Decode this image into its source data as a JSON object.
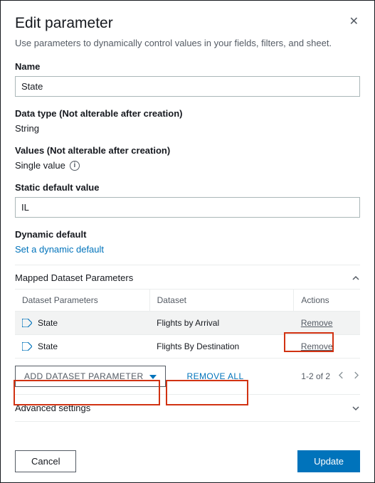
{
  "dialog": {
    "title": "Edit parameter",
    "subtitle": "Use parameters to dynamically control values in your fields, filters, and sheet."
  },
  "fields": {
    "name_label": "Name",
    "name_value": "State",
    "datatype_label": "Data type (Not alterable after creation)",
    "datatype_value": "String",
    "values_label": "Values (Not alterable after creation)",
    "values_value": "Single value",
    "static_label": "Static default value",
    "static_value": "IL",
    "dynamic_label": "Dynamic default",
    "dynamic_link": "Set a dynamic default"
  },
  "mapped": {
    "section_title": "Mapped Dataset Parameters",
    "col_param": "Dataset Parameters",
    "col_dataset": "Dataset",
    "col_actions": "Actions",
    "rows": [
      {
        "param": "State",
        "dataset": "Flights by Arrival",
        "action": "Remove"
      },
      {
        "param": "State",
        "dataset": "Flights By Destination",
        "action": "Remove"
      }
    ],
    "add_btn": "ADD DATASET PARAMETER",
    "remove_all": "REMOVE ALL",
    "pager": "1-2 of 2"
  },
  "advanced": {
    "title": "Advanced settings"
  },
  "footer": {
    "cancel": "Cancel",
    "update": "Update"
  }
}
